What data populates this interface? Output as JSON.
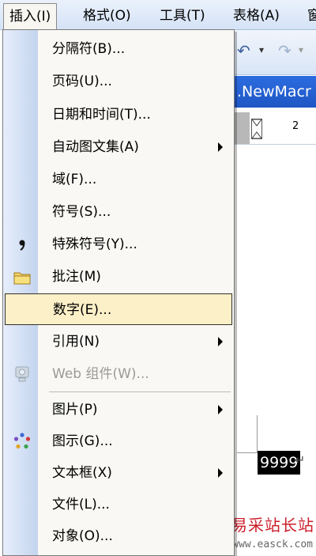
{
  "menubar": {
    "items": [
      {
        "label": "插入(I)"
      },
      {
        "label": "格式(O)"
      },
      {
        "label": "工具(T)"
      },
      {
        "label": "表格(A)"
      },
      {
        "label": "窗"
      }
    ]
  },
  "background": {
    "window_title_fragment": ".NewMacr",
    "ruler_number": "2",
    "selected_text": "9999",
    "paragraph_mark": "↵"
  },
  "menu": {
    "items": [
      {
        "label": "分隔符(B)...",
        "has_submenu": false,
        "disabled": false
      },
      {
        "label": "页码(U)...",
        "has_submenu": false,
        "disabled": false
      },
      {
        "label": "日期和时间(T)...",
        "has_submenu": false,
        "disabled": false
      },
      {
        "label": "自动图文集(A)",
        "has_submenu": true,
        "disabled": false
      },
      {
        "label": "域(F)...",
        "has_submenu": false,
        "disabled": false
      },
      {
        "label": "符号(S)...",
        "has_submenu": false,
        "disabled": false
      },
      {
        "label": "特殊符号(Y)...",
        "has_submenu": false,
        "disabled": false,
        "icon": "comma-icon"
      },
      {
        "label": "批注(M)",
        "has_submenu": false,
        "disabled": false,
        "icon": "folder-note-icon"
      },
      {
        "label": "数字(E)...",
        "has_submenu": false,
        "disabled": false,
        "selected": true
      },
      {
        "label": "引用(N)",
        "has_submenu": true,
        "disabled": false
      },
      {
        "label": "Web 组件(W)...",
        "has_submenu": false,
        "disabled": true,
        "icon": "web-component-icon"
      },
      {
        "label": "图片(P)",
        "has_submenu": true,
        "disabled": false
      },
      {
        "label": "图示(G)...",
        "has_submenu": false,
        "disabled": false,
        "icon": "diagram-icon"
      },
      {
        "label": "文本框(X)",
        "has_submenu": true,
        "disabled": false
      },
      {
        "label": "文件(L)...",
        "has_submenu": false,
        "disabled": false
      },
      {
        "label": "对象(O)...",
        "has_submenu": false,
        "disabled": false
      }
    ]
  },
  "watermark": {
    "title": "易采站长站",
    "url": "www.easck.com"
  }
}
